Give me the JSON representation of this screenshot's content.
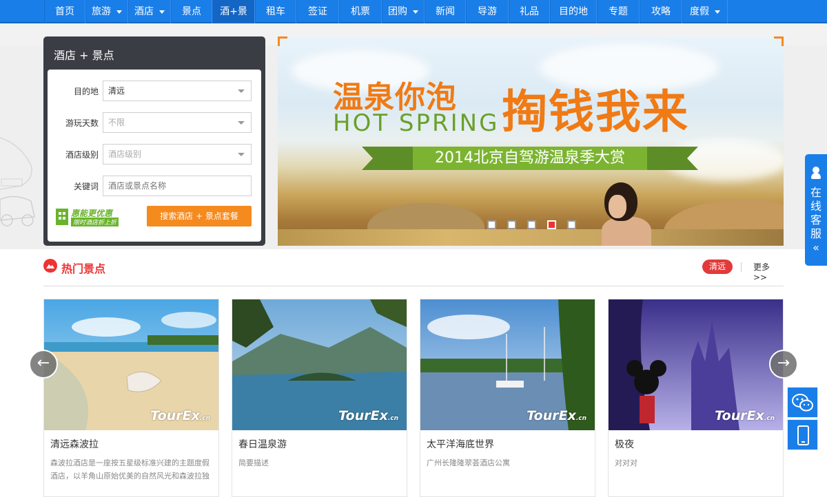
{
  "nav": [
    {
      "label": "首页",
      "caret": false,
      "active": false
    },
    {
      "label": "旅游",
      "caret": true,
      "active": false
    },
    {
      "label": "酒店",
      "caret": true,
      "active": false
    },
    {
      "label": "景点",
      "caret": false,
      "active": false
    },
    {
      "label": "酒+景",
      "caret": false,
      "active": true
    },
    {
      "label": "租车",
      "caret": false,
      "active": false
    },
    {
      "label": "签证",
      "caret": false,
      "active": false
    },
    {
      "label": "机票",
      "caret": false,
      "active": false
    },
    {
      "label": "团购",
      "caret": true,
      "active": false
    },
    {
      "label": "新闻",
      "caret": false,
      "active": false
    },
    {
      "label": "导游",
      "caret": false,
      "active": false
    },
    {
      "label": "礼品",
      "caret": false,
      "active": false
    },
    {
      "label": "目的地",
      "caret": false,
      "active": false
    },
    {
      "label": "专题",
      "caret": false,
      "active": false
    },
    {
      "label": "攻略",
      "caret": false,
      "active": false
    },
    {
      "label": "度假",
      "caret": true,
      "active": false
    }
  ],
  "search": {
    "title": "酒店 + 景点",
    "destination": {
      "label": "目的地",
      "value": "清远"
    },
    "days": {
      "label": "游玩天数",
      "value": "不限"
    },
    "level": {
      "label": "酒店级别",
      "value": "酒店级别"
    },
    "keyword": {
      "label": "关键词",
      "placeholder": "酒店或景点名称"
    },
    "promo_line1": "惠能更优惠",
    "promo_line2": "限时酒店折上折",
    "button": "搜索酒店 + 景点套餐"
  },
  "banner": {
    "title_left": "温泉你泡",
    "title_right": "掏钱我来",
    "subtitle_en": "HOT SPRING",
    "ribbon": "2014北京自驾游温泉季大赏",
    "slides": 5,
    "active_slide": 4
  },
  "service": {
    "label": "在线客服",
    "chevron": "«"
  },
  "hot": {
    "title": "热门景点",
    "city": "清远",
    "more": "更多>>"
  },
  "cards": [
    {
      "name": "清远森波拉",
      "desc": "森波拉酒店是一座按五星级标准兴建的主题度假酒店，以羊角山原始优美的自然风光和森波拉独"
    },
    {
      "name": "春日温泉游",
      "desc": "简要描述"
    },
    {
      "name": "太平洋海底世界",
      "desc": "广州长隆隆翠荟酒店公寓"
    },
    {
      "name": "极夜",
      "desc": "对对对"
    }
  ],
  "watermark": {
    "main": "TourEx",
    "suffix": ".cn"
  },
  "colors": {
    "nav": "#1a7ee8",
    "accent": "#f58a1e",
    "hot": "#e33333"
  }
}
